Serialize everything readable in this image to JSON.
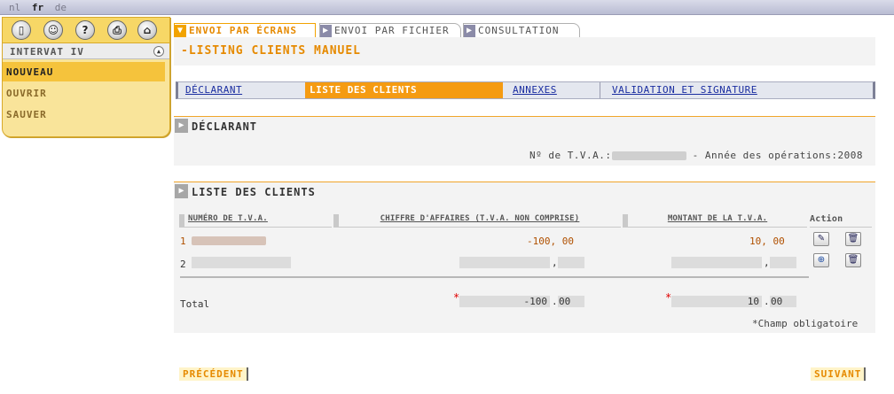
{
  "languages": [
    {
      "code": "nl",
      "active": false
    },
    {
      "code": "fr",
      "active": true
    },
    {
      "code": "de",
      "active": false
    }
  ],
  "app": {
    "title": "INTERVAT IV"
  },
  "toolbar_icons": [
    "door-exit-icon",
    "user-icon",
    "help-icon",
    "print-icon",
    "home-icon"
  ],
  "menu": [
    {
      "label": "NOUVEAU",
      "selected": true
    },
    {
      "label": "OUVRIR",
      "selected": false
    },
    {
      "label": "SAUVER",
      "selected": false
    }
  ],
  "main_tabs": [
    {
      "label": "ENVOI PAR ÉCRANS",
      "active": true
    },
    {
      "label": "ENVOI PAR FICHIER",
      "active": false
    },
    {
      "label": "CONSULTATION",
      "active": false
    }
  ],
  "page_title": "-LISTING CLIENTS MANUEL",
  "sub_tabs": [
    {
      "label": "DÉCLARANT",
      "active": false
    },
    {
      "label": "LISTE DES CLIENTS",
      "active": true
    },
    {
      "label": "ANNEXES",
      "active": false
    },
    {
      "label": "VALIDATION ET SIGNATURE",
      "active": false
    }
  ],
  "declarant": {
    "section_title": "DÉCLARANT",
    "vat_label": "Nº de T.V.A.:",
    "year_label": "- Année des opérations:",
    "year_value": "2008"
  },
  "clients": {
    "section_title": "LISTE DES CLIENTS",
    "columns": {
      "vat": "NUMÉRO DE T.V.A.",
      "turnover": "CHIFFRE D'AFFAIRES (T.V.A. NON COMPRISE)",
      "vat_amount": "MONTANT DE LA T.V.A.",
      "action": "Action"
    },
    "rows": [
      {
        "index": "1",
        "turnover": "-100, 00",
        "vat_amount": "10, 00"
      },
      {
        "index": "2"
      }
    ],
    "total_label": "Total",
    "total_turnover_int": "-100",
    "total_turnover_dec": "00",
    "total_vat_int": "10",
    "total_vat_dec": "00",
    "required_star": "*",
    "required_note": "*Champ obligatoire"
  },
  "footer": {
    "prev": "PRÉCÉDENT",
    "next": "SUIVANT"
  }
}
